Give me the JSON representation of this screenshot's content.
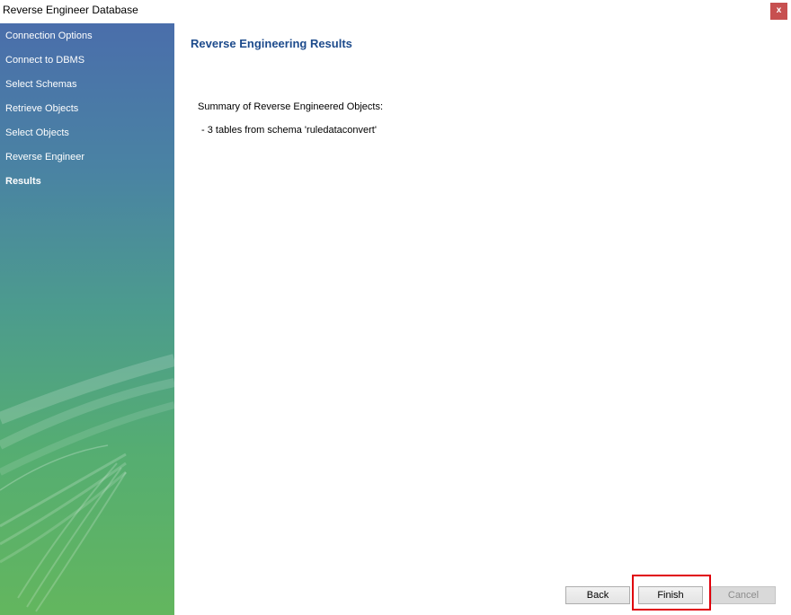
{
  "window": {
    "title": "Reverse Engineer Database",
    "close_label": "x"
  },
  "sidebar": {
    "items": [
      {
        "label": "Connection Options",
        "active": false
      },
      {
        "label": "Connect to DBMS",
        "active": false
      },
      {
        "label": "Select Schemas",
        "active": false
      },
      {
        "label": "Retrieve Objects",
        "active": false
      },
      {
        "label": "Select Objects",
        "active": false
      },
      {
        "label": "Reverse Engineer",
        "active": false
      },
      {
        "label": "Results",
        "active": true
      }
    ]
  },
  "main": {
    "title": "Reverse Engineering Results",
    "summary_heading": "Summary of Reverse Engineered Objects:",
    "summary_lines": [
      " - 3 tables from schema 'ruledataconvert'"
    ]
  },
  "buttons": {
    "back": {
      "label": "Back",
      "enabled": true
    },
    "finish": {
      "label": "Finish",
      "enabled": true,
      "highlighted": true
    },
    "cancel": {
      "label": "Cancel",
      "enabled": false
    }
  },
  "colors": {
    "title_accent": "#1d4b8c",
    "highlight": "#e0000b",
    "close_button": "#c75050"
  }
}
